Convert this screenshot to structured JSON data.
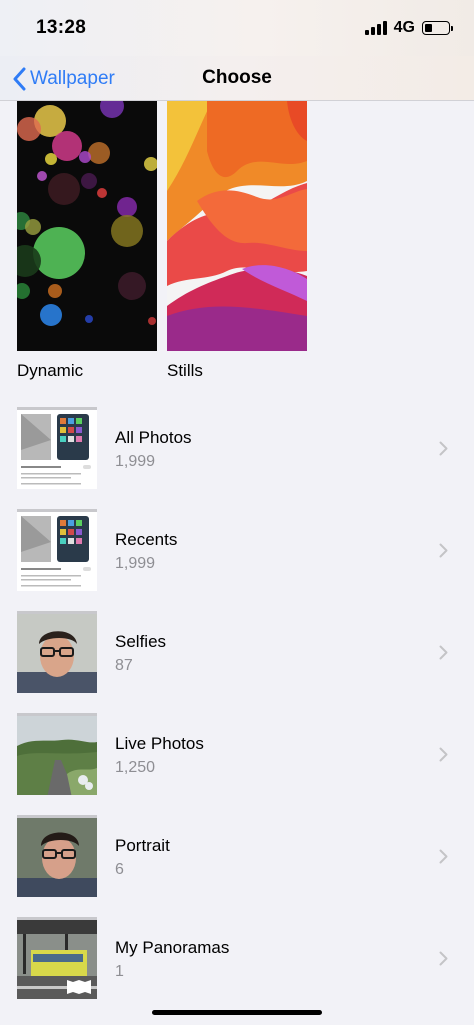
{
  "status_bar": {
    "time": "13:28",
    "network": "4G",
    "battery_level": 0.3
  },
  "nav": {
    "back_label": "Wallpaper",
    "title": "Choose"
  },
  "categories": [
    {
      "label": "Dynamic"
    },
    {
      "label": "Stills"
    }
  ],
  "albums": [
    {
      "name": "All Photos",
      "count": "1,999",
      "thumb": "screenshot"
    },
    {
      "name": "Recents",
      "count": "1,999",
      "thumb": "screenshot"
    },
    {
      "name": "Selfies",
      "count": "87",
      "thumb": "portrait"
    },
    {
      "name": "Live Photos",
      "count": "1,250",
      "thumb": "landscape"
    },
    {
      "name": "Portrait",
      "count": "6",
      "thumb": "portrait"
    },
    {
      "name": "My Panoramas",
      "count": "1",
      "thumb": "station"
    }
  ],
  "colors": {
    "accent": "#2f7cf6",
    "secondary_text": "#8e8e93",
    "chevron": "#c4c4c7"
  }
}
